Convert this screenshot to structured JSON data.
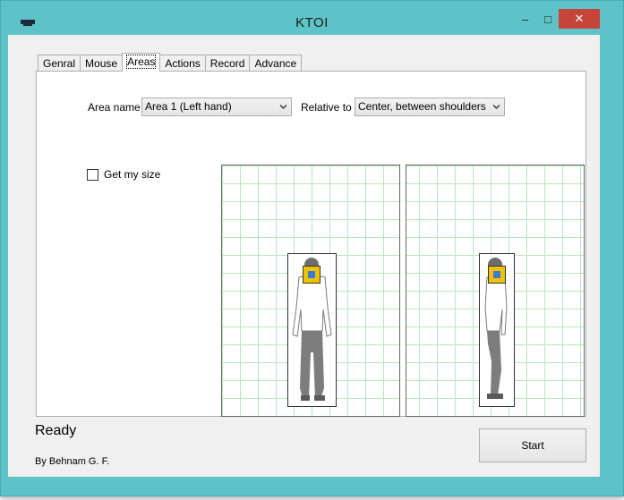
{
  "window": {
    "title": "KTOI",
    "minimize_glyph": "–",
    "maximize_glyph": "□",
    "close_glyph": "✕"
  },
  "tabs": [
    {
      "label": "Genral"
    },
    {
      "label": "Mouse"
    },
    {
      "label": "Areas",
      "active": true
    },
    {
      "label": "Actions"
    },
    {
      "label": "Record"
    },
    {
      "label": "Advance"
    }
  ],
  "areas": {
    "area_name_label": "Area name",
    "area_name_value": "Area 1 (Left hand)",
    "relative_to_label": "Relative to",
    "relative_to_value": "Center, between shoulders",
    "get_my_size_label": "Get my size",
    "get_my_size_checked": false
  },
  "status": {
    "text": "Ready",
    "credit": "By Behnam G. F."
  },
  "start_button": {
    "label": "Start"
  },
  "colors": {
    "frame": "#5ec3c8",
    "close": "#c7443a",
    "grid_line": "#b9e8b9",
    "area_fill": "#f2c200",
    "area_center": "#3a7bd5"
  },
  "icons": {
    "window_icon": "app-icon",
    "combo_arrow": "chevron-down-icon"
  }
}
